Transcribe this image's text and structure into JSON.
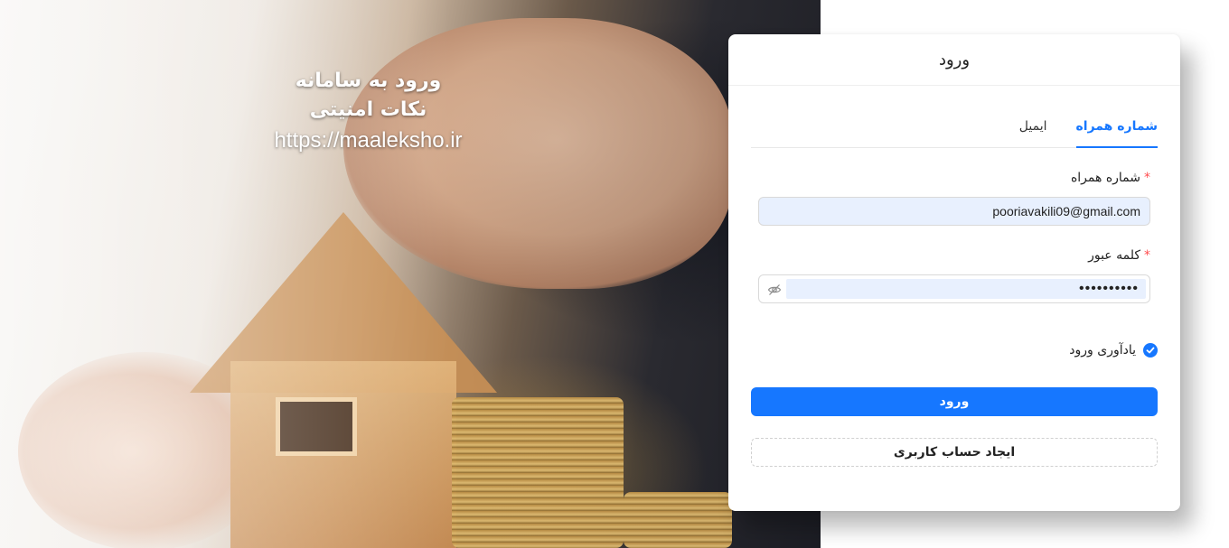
{
  "hero": {
    "line1": "ورود به سامانه",
    "line2": "نکات امنیتی",
    "line3": "https://maaleksho.ir"
  },
  "card": {
    "title": "ورود",
    "tabs": [
      {
        "label": "شماره همراه",
        "active": true
      },
      {
        "label": "ایمیل",
        "active": false
      }
    ],
    "phone_field": {
      "required_mark": "*",
      "label": "شماره همراه",
      "value": "pooriavakili09@gmail.com"
    },
    "password_field": {
      "required_mark": "*",
      "label": "کلمه عبور",
      "value": "••••••••••",
      "toggle_icon": "eye-slash-icon"
    },
    "remember": {
      "label": "یادآوری ورود",
      "checked": true
    },
    "login_button": "ورود",
    "register_button": "ایجاد حساب کاربری"
  },
  "colors": {
    "accent": "#1677ff",
    "required": "#ff4d4f",
    "autofill": "#e8f0fe"
  }
}
